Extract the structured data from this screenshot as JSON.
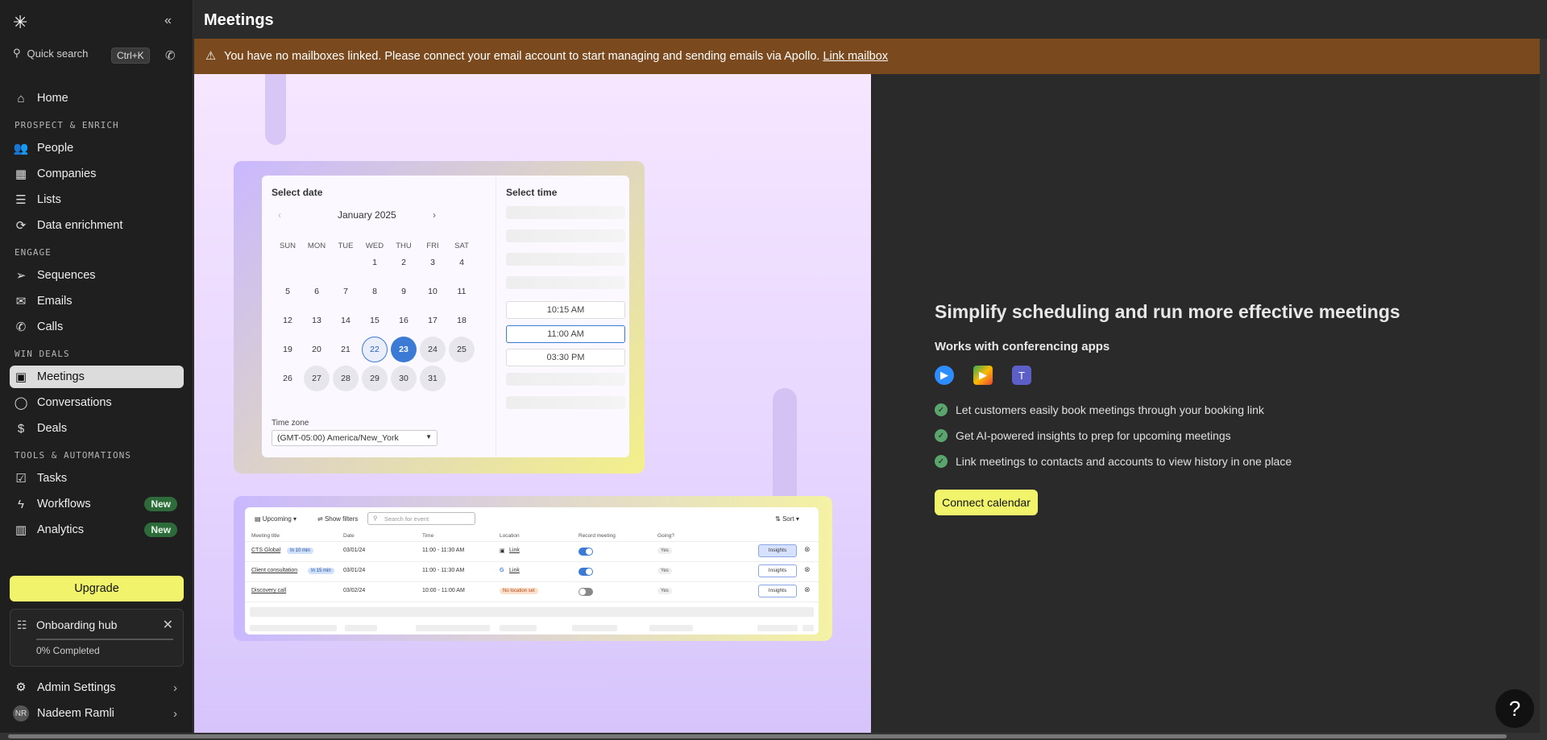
{
  "sidebar": {
    "search_label": "Quick search",
    "search_shortcut": "Ctrl+K",
    "items": [
      {
        "label": "Home"
      },
      {
        "section": "PROSPECT & ENRICH"
      },
      {
        "label": "People"
      },
      {
        "label": "Companies"
      },
      {
        "label": "Lists"
      },
      {
        "label": "Data enrichment"
      },
      {
        "section": "ENGAGE"
      },
      {
        "label": "Sequences"
      },
      {
        "label": "Emails"
      },
      {
        "label": "Calls"
      },
      {
        "section": "WIN DEALS"
      },
      {
        "label": "Meetings"
      },
      {
        "label": "Conversations"
      },
      {
        "label": "Deals"
      },
      {
        "section": "TOOLS & AUTOMATIONS"
      },
      {
        "label": "Tasks"
      },
      {
        "label": "Workflows",
        "badge": "New"
      },
      {
        "label": "Analytics",
        "badge": "New"
      }
    ],
    "upgrade_label": "Upgrade",
    "onboarding": {
      "title": "Onboarding hub",
      "progress": "0% Completed"
    },
    "admin_label": "Admin Settings",
    "user": {
      "name": "Nadeem Ramli",
      "initials": "NR"
    }
  },
  "header": {
    "title": "Meetings"
  },
  "banner": {
    "text": "You have no mailboxes linked. Please connect your email account to start managing and sending emails via Apollo.",
    "link": "Link mailbox"
  },
  "calendar": {
    "date_heading": "Select date",
    "time_heading": "Select time",
    "month": "January 2025",
    "weekdays": [
      "SUN",
      "MON",
      "TUE",
      "WED",
      "THU",
      "FRI",
      "SAT"
    ],
    "weeks": [
      [
        "",
        "",
        "",
        "1",
        "2",
        "3",
        "4"
      ],
      [
        "5",
        "6",
        "7",
        "8",
        "9",
        "10",
        "11"
      ],
      [
        "12",
        "13",
        "14",
        "15",
        "16",
        "17",
        "18"
      ],
      [
        "19",
        "20",
        "21",
        "22",
        "23",
        "24",
        "25"
      ],
      [
        "26",
        "27",
        "28",
        "29",
        "30",
        "31",
        ""
      ]
    ],
    "timezone_label": "Time zone",
    "timezone_value": "(GMT-05:00) America/New_York",
    "times": [
      "10:15 AM",
      "11:00 AM",
      "03:30 PM"
    ]
  },
  "table_preview": {
    "toolbar": {
      "upcoming": "Upcoming",
      "filters": "Show filters",
      "search_placeholder": "Search for event",
      "sort": "Sort"
    },
    "columns": [
      "Meeting title",
      "Date",
      "Time",
      "Location",
      "Record meeting",
      "Going?"
    ],
    "rows": [
      {
        "title": "CTS Global",
        "chip": "In 10 min",
        "date": "03/01/24",
        "time": "11:00 - 11:30 AM",
        "location": "Link",
        "going": "Yes",
        "insights": "Insights"
      },
      {
        "title": "Client consultation",
        "chip": "In 15 min",
        "date": "03/01/24",
        "time": "11:00 - 11:30 AM",
        "location": "Link",
        "going": "Yes",
        "insights": "Insights"
      },
      {
        "title": "Discovery call",
        "chip": "",
        "date": "03/02/24",
        "time": "10:00 - 11:00 AM",
        "location": "No location set",
        "going": "Yes",
        "insights": "Insights"
      }
    ]
  },
  "promo": {
    "title": "Simplify scheduling and run more effective meetings",
    "subtitle": "Works with conferencing apps",
    "features": [
      "Let customers easily book meetings through your booking link",
      "Get AI-powered insights to prep for upcoming meetings",
      "Link meetings to contacts and accounts to view history in one place"
    ],
    "cta": "Connect calendar"
  },
  "help_label": "?",
  "colors": {
    "accent_yellow": "#f1f46b",
    "banner": "#7a4a1e",
    "selected_blue": "#3b7bd6",
    "new_badge": "#2e6b3a"
  }
}
